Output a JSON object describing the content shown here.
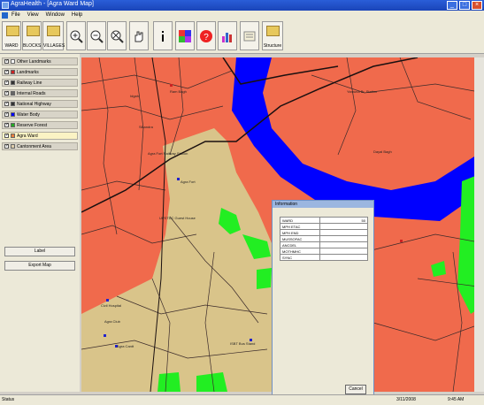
{
  "window": {
    "title": "AgraHealth - [Agra Ward Map]"
  },
  "menu": [
    "File",
    "View",
    "Window",
    "Help"
  ],
  "toolbar": {
    "buttons": [
      {
        "label": "WARD",
        "icon": "folder-icon"
      },
      {
        "label": "BLOCKS",
        "icon": "folder-icon"
      },
      {
        "label": "VILLAGES",
        "icon": "folder-icon"
      },
      {
        "label": "",
        "icon": "zoom-in-icon"
      },
      {
        "label": "",
        "icon": "zoom-out-icon"
      },
      {
        "label": "",
        "icon": "full-extent-icon"
      },
      {
        "label": "",
        "icon": "pan-hand-icon"
      },
      {
        "label": "",
        "icon": "info-icon"
      },
      {
        "label": "",
        "icon": "color-legend-icon"
      },
      {
        "label": "",
        "icon": "help-icon"
      },
      {
        "label": "",
        "icon": "bar-chart-icon"
      },
      {
        "label": "",
        "icon": "report-icon"
      },
      {
        "label": "Structure",
        "icon": "structure-icon"
      }
    ]
  },
  "layers": [
    {
      "label": "Other Landmarks",
      "color": "#ffffff",
      "checked": true
    },
    {
      "label": "Landmarks",
      "color": "#cc2222",
      "checked": true
    },
    {
      "label": "Railway Line",
      "color": "#333333",
      "checked": true
    },
    {
      "label": "Internal Roads",
      "color": "#666666",
      "checked": true
    },
    {
      "label": "National Highway",
      "color": "#333333",
      "checked": true
    },
    {
      "label": "Water Body",
      "color": "#0000ff",
      "checked": true
    },
    {
      "label": "Reserve Forest",
      "color": "#22aa22",
      "checked": true
    },
    {
      "label": "Agra Ward",
      "color": "#e88040",
      "checked": true,
      "selected": true
    },
    {
      "label": "Cantonment Area",
      "color": "#ddccaa",
      "checked": true
    }
  ],
  "panel": {
    "label_button": "Label",
    "export_button": "Export Map"
  },
  "map": {
    "colors": {
      "ward": "#f06a4c",
      "cantonment": "#d9c48a",
      "water": "#0000ff",
      "forest": "#22ee22",
      "roads": "#3a2a2a"
    },
    "labels": [
      {
        "text": "Agra Fort"
      },
      {
        "text": "Agra Fort Railway Station"
      },
      {
        "text": "UPSTDC Guest House"
      },
      {
        "text": "Civil Hospital"
      },
      {
        "text": "Agra Club"
      },
      {
        "text": "ISBT Bus Stand"
      },
      {
        "text": "Agra Cantt"
      },
      {
        "text": "Idgah"
      },
      {
        "text": "Ram Bagh"
      },
      {
        "text": "Yamuna Br. Station"
      },
      {
        "text": "Dayal Bagh"
      },
      {
        "text": "Sikandra"
      },
      {
        "text": "Bhagwan Talkies"
      }
    ]
  },
  "info_dialog": {
    "title": "Information",
    "rows": [
      "WARD",
      "MPH ETAC",
      "MPH END",
      "MUSSOFAC",
      "ANCDEL",
      "MOTHMHC",
      "SYNC"
    ],
    "value": "50",
    "cancel": "Cancel"
  },
  "status": {
    "left": "Status",
    "date": "3/11/2008",
    "time": "9:45 AM"
  }
}
